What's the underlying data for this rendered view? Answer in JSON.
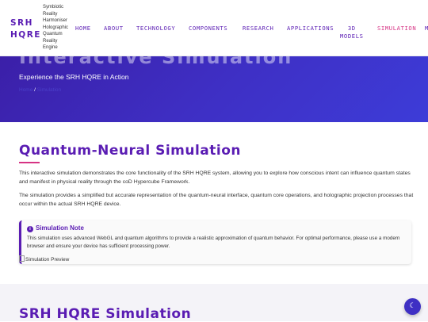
{
  "brand": {
    "logo_line1": "SRH",
    "logo_line2": "HQRE",
    "tagline": [
      "Symbiotic",
      "Reality",
      "Harmoniser",
      "Holographic",
      "Quantum",
      "Reality",
      "Engine"
    ]
  },
  "nav": {
    "items": [
      {
        "label": "HOME"
      },
      {
        "label": "ABOUT"
      },
      {
        "label": "TECHNOLOGY"
      },
      {
        "label": "COMPONENTS"
      },
      {
        "label": "RESEARCH"
      },
      {
        "label": "APPLICATIONS"
      },
      {
        "label": "3D",
        "label2": "MODELS"
      },
      {
        "label": "SIMULATION",
        "active": true
      },
      {
        "label": "M"
      }
    ]
  },
  "hero": {
    "title": "Interactive Simulation",
    "subtitle": "Experience the SRH HQRE in Action",
    "breadcrumb_home": "Home",
    "breadcrumb_sep": "/",
    "breadcrumb_current": "Simulation"
  },
  "main": {
    "title": "Quantum-Neural Simulation",
    "para1": "This interactive simulation demonstrates the core functionality of the SRH HQRE system, allowing you to explore how conscious intent can influence quantum states and manifest in physical reality through the coD Hypercube Framework.",
    "para2": "The simulation provides a simplified but accurate representation of the quantum-neural interface, quantum core operations, and holographic projection processes that occur within the actual SRH HQRE device.",
    "note": {
      "title": "Simulation Note",
      "text": "This simulation uses advanced WebGL and quantum algorithms to provide a realistic approximation of quantum behavior. For optimal performance, please use a modern browser and ensure your device has sufficient processing power."
    },
    "preview_alt": "Simulation Preview"
  },
  "lower": {
    "title": "SRH HQRE Simulation"
  },
  "theme_toggle": {
    "icon": "moon-icon"
  },
  "colors": {
    "brand": "#5a1cb3",
    "accent": "#d63384",
    "hero": "#3e2fc4"
  }
}
